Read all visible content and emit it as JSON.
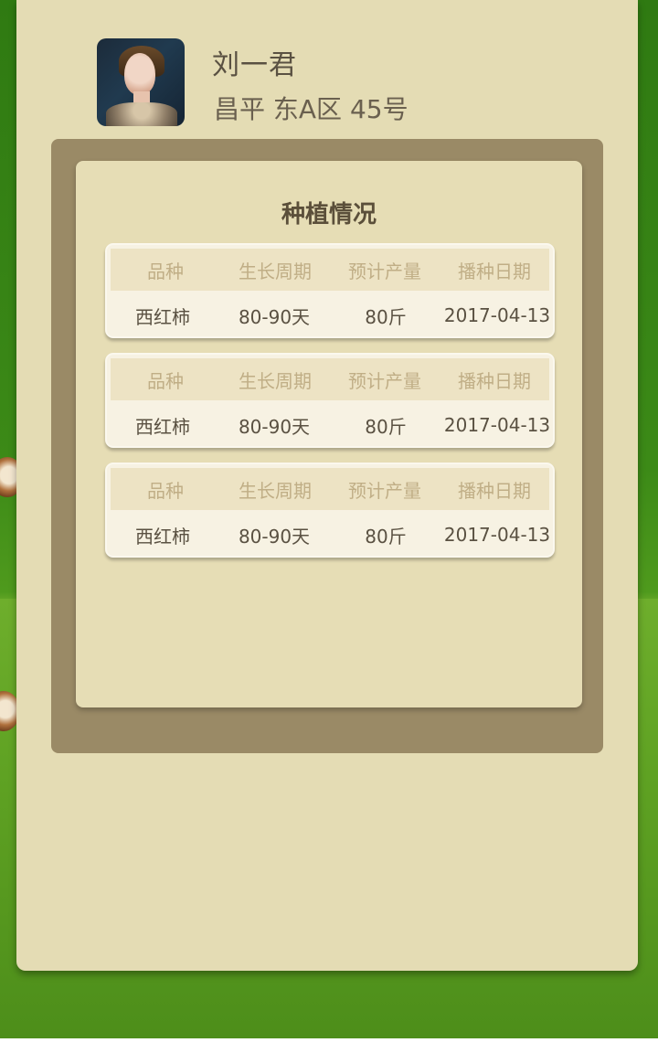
{
  "profile": {
    "name": "刘一君",
    "address": "昌平 东A区 45号"
  },
  "planting": {
    "title": "种植情况",
    "columns": [
      "品种",
      "生长周期",
      "预计产量",
      "播种日期"
    ],
    "records": [
      {
        "variety": "西红柿",
        "cycle": "80-90天",
        "yield": "80斤",
        "date": "2017-04-13"
      },
      {
        "variety": "西红柿",
        "cycle": "80-90天",
        "yield": "80斤",
        "date": "2017-04-13"
      },
      {
        "variety": "西红柿",
        "cycle": "80-90天",
        "yield": "80斤",
        "date": "2017-04-13"
      }
    ]
  },
  "colors": {
    "card": "#e4dcb4",
    "frame": "#9a8a66",
    "panel": "#e6ddb5",
    "header_text": "#c0ae86",
    "value_text": "#5a5142"
  },
  "icons": {
    "avatar": "user-avatar-photo"
  }
}
